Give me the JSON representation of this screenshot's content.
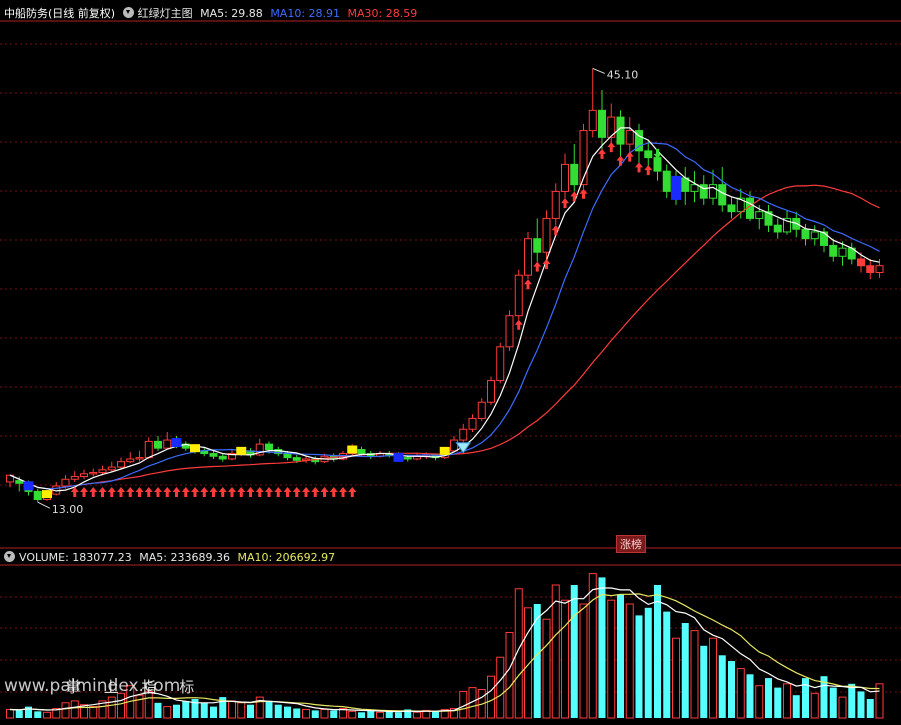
{
  "header": {
    "stock_name": "中船防务",
    "period": "(日线 前复权)",
    "indicator_name": "红绿灯主图",
    "ma5_label": "MA5: 29.88",
    "ma10_label": "MA10: 28.91",
    "ma30_label": "MA30: 28.59"
  },
  "volume_header": {
    "label": "VOLUME: 183077.23",
    "ma5_label": "MA5: 233689.36",
    "ma10_label": "MA10: 206692.97"
  },
  "badge": "涨榜",
  "watermark": {
    "site": "www.palmindex.com",
    "text": "掌 上 指 标"
  },
  "colors": {
    "up": "#ff3b3b",
    "down": "#55ffff",
    "ma5": "#ffffff",
    "ma10": "#3b6cff",
    "ma30": "#ff3b3b",
    "green_candle": "#33dd33",
    "signal_yellow": "#ffee00",
    "signal_blue": "#1a2bff"
  },
  "chart_data": {
    "type": "candlestick",
    "price_range": [
      10.5,
      47.5
    ],
    "max_label": "45.10",
    "min_label": "13.00",
    "max_index": 63,
    "min_index": 3,
    "candles": [
      [
        14.5,
        15.0,
        14.1,
        14.6
      ],
      [
        14.6,
        14.4,
        13.8,
        14.9
      ],
      [
        14.4,
        13.8,
        13.5,
        14.6
      ],
      [
        13.8,
        13.2,
        13.0,
        14.0
      ],
      [
        13.2,
        13.6,
        13.1,
        13.9
      ],
      [
        13.6,
        14.2,
        13.5,
        14.5
      ],
      [
        14.2,
        14.7,
        14.0,
        15.0
      ],
      [
        14.7,
        14.9,
        14.5,
        15.3
      ],
      [
        14.9,
        15.1,
        14.7,
        15.4
      ],
      [
        15.1,
        15.2,
        14.9,
        15.5
      ],
      [
        15.2,
        15.4,
        15.0,
        15.7
      ],
      [
        15.4,
        15.6,
        15.2,
        16.0
      ],
      [
        15.6,
        16.0,
        15.5,
        16.3
      ],
      [
        16.0,
        16.2,
        15.9,
        16.7
      ],
      [
        16.2,
        16.3,
        16.0,
        16.8
      ],
      [
        16.3,
        17.5,
        16.2,
        17.8
      ],
      [
        17.5,
        17.0,
        16.8,
        17.9
      ],
      [
        17.0,
        17.6,
        16.9,
        18.2
      ],
      [
        17.6,
        17.3,
        17.0,
        17.9
      ],
      [
        17.3,
        17.0,
        16.8,
        17.5
      ],
      [
        17.0,
        16.8,
        16.6,
        17.2
      ],
      [
        16.8,
        16.6,
        16.4,
        17.0
      ],
      [
        16.6,
        16.4,
        16.2,
        16.8
      ],
      [
        16.4,
        16.2,
        16.0,
        16.6
      ],
      [
        16.2,
        16.6,
        16.1,
        16.9
      ],
      [
        16.6,
        16.8,
        16.4,
        17.0
      ],
      [
        16.8,
        16.5,
        16.3,
        17.0
      ],
      [
        16.5,
        17.3,
        16.4,
        17.7
      ],
      [
        17.3,
        16.9,
        16.6,
        17.5
      ],
      [
        16.9,
        16.6,
        16.4,
        17.1
      ],
      [
        16.6,
        16.3,
        16.1,
        16.8
      ],
      [
        16.3,
        16.1,
        15.9,
        16.5
      ],
      [
        16.1,
        16.2,
        15.9,
        16.4
      ],
      [
        16.2,
        16.0,
        15.8,
        16.4
      ],
      [
        16.0,
        16.4,
        15.9,
        16.6
      ],
      [
        16.4,
        16.2,
        16.0,
        16.6
      ],
      [
        16.2,
        16.6,
        16.1,
        16.8
      ],
      [
        16.6,
        16.9,
        16.5,
        17.3
      ],
      [
        16.9,
        16.6,
        16.4,
        17.1
      ],
      [
        16.6,
        16.4,
        16.2,
        16.8
      ],
      [
        16.4,
        16.6,
        16.3,
        16.8
      ],
      [
        16.6,
        16.5,
        16.3,
        16.8
      ],
      [
        16.5,
        16.3,
        16.1,
        16.7
      ],
      [
        16.3,
        16.2,
        16.0,
        16.5
      ],
      [
        16.2,
        16.4,
        16.1,
        16.6
      ],
      [
        16.4,
        16.5,
        16.2,
        16.7
      ],
      [
        16.5,
        16.3,
        16.1,
        16.6
      ],
      [
        16.3,
        16.8,
        16.2,
        17.0
      ],
      [
        16.8,
        17.6,
        16.7,
        17.9
      ],
      [
        17.6,
        18.4,
        17.4,
        18.8
      ],
      [
        18.4,
        19.2,
        18.2,
        19.5
      ],
      [
        19.2,
        20.4,
        19.0,
        20.7
      ],
      [
        20.4,
        22.0,
        20.2,
        22.3
      ],
      [
        22.0,
        24.5,
        21.8,
        24.8
      ],
      [
        24.5,
        26.8,
        24.2,
        27.2
      ],
      [
        26.8,
        29.8,
        26.5,
        30.2
      ],
      [
        29.8,
        32.5,
        29.5,
        33.0
      ],
      [
        32.5,
        31.5,
        30.8,
        34.0
      ],
      [
        31.5,
        34.0,
        31.0,
        34.6
      ],
      [
        34.0,
        36.0,
        33.5,
        36.6
      ],
      [
        36.0,
        38.0,
        35.5,
        38.8
      ],
      [
        38.0,
        36.5,
        36.0,
        39.5
      ],
      [
        36.5,
        40.5,
        36.2,
        41.0
      ],
      [
        40.5,
        42.0,
        40.0,
        45.1
      ],
      [
        42.0,
        40.0,
        39.0,
        43.5
      ],
      [
        40.0,
        41.5,
        39.5,
        42.5
      ],
      [
        41.5,
        39.5,
        38.5,
        42.0
      ],
      [
        39.5,
        40.5,
        38.8,
        41.5
      ],
      [
        40.5,
        39.0,
        38.0,
        41.0
      ],
      [
        39.0,
        38.5,
        37.8,
        39.8
      ],
      [
        38.5,
        37.5,
        36.8,
        39.0
      ],
      [
        37.5,
        36.0,
        35.5,
        38.0
      ],
      [
        36.0,
        37.0,
        35.0,
        37.5
      ],
      [
        37.0,
        36.0,
        35.0,
        37.8
      ],
      [
        36.0,
        36.5,
        35.2,
        37.5
      ],
      [
        36.5,
        35.5,
        35.0,
        37.2
      ],
      [
        35.5,
        36.5,
        35.0,
        37.6
      ],
      [
        36.5,
        35.0,
        34.5,
        37.8
      ],
      [
        35.0,
        34.5,
        34.0,
        35.6
      ],
      [
        34.5,
        35.5,
        34.0,
        36.2
      ],
      [
        35.5,
        34.0,
        33.8,
        36.0
      ],
      [
        34.0,
        34.5,
        33.2,
        35.0
      ],
      [
        34.5,
        33.5,
        33.0,
        35.0
      ],
      [
        33.5,
        33.0,
        32.5,
        34.0
      ],
      [
        33.0,
        34.0,
        32.8,
        34.6
      ],
      [
        34.0,
        33.2,
        32.6,
        34.5
      ],
      [
        33.2,
        32.5,
        32.0,
        33.6
      ],
      [
        32.5,
        33.0,
        32.0,
        33.5
      ],
      [
        33.0,
        32.0,
        31.5,
        33.3
      ],
      [
        32.0,
        31.2,
        30.8,
        32.5
      ],
      [
        31.2,
        31.8,
        30.5,
        32.3
      ],
      [
        31.8,
        31.0,
        30.6,
        32.2
      ],
      [
        31.0,
        30.5,
        30.0,
        31.5
      ],
      [
        30.5,
        30.0,
        29.5,
        31.0
      ],
      [
        30.0,
        30.5,
        29.6,
        31.0
      ]
    ],
    "up_arrow_ranges": [
      [
        7,
        37
      ],
      [
        55,
        62
      ],
      [
        64,
        69
      ]
    ],
    "down_marker_index": 70,
    "yellow_blocks": [
      4,
      20,
      25,
      37,
      47
    ],
    "blue_blocks": [
      2,
      18,
      42,
      72
    ],
    "diamond_index": 49,
    "volume_range": [
      0,
      800000
    ],
    "volume": [
      45000,
      40000,
      60000,
      35000,
      30000,
      50000,
      80000,
      90000,
      70000,
      60000,
      90000,
      110000,
      130000,
      170000,
      120000,
      140000,
      80000,
      60000,
      70000,
      90000,
      100000,
      80000,
      60000,
      110000,
      90000,
      80000,
      70000,
      110000,
      90000,
      70000,
      60000,
      50000,
      45000,
      40000,
      45000,
      40000,
      50000,
      35000,
      30000,
      40000,
      30000,
      35000,
      30000,
      45000,
      30000,
      40000,
      35000,
      45000,
      50000,
      140000,
      160000,
      150000,
      220000,
      320000,
      450000,
      680000,
      580000,
      600000,
      520000,
      700000,
      620000,
      700000,
      600000,
      760000,
      740000,
      620000,
      650000,
      600000,
      540000,
      580000,
      700000,
      560000,
      420000,
      500000,
      460000,
      380000,
      420000,
      330000,
      300000,
      260000,
      230000,
      170000,
      210000,
      160000,
      180000,
      120000,
      210000,
      130000,
      220000,
      160000,
      110000,
      180000,
      140000,
      100000,
      180000
    ]
  }
}
